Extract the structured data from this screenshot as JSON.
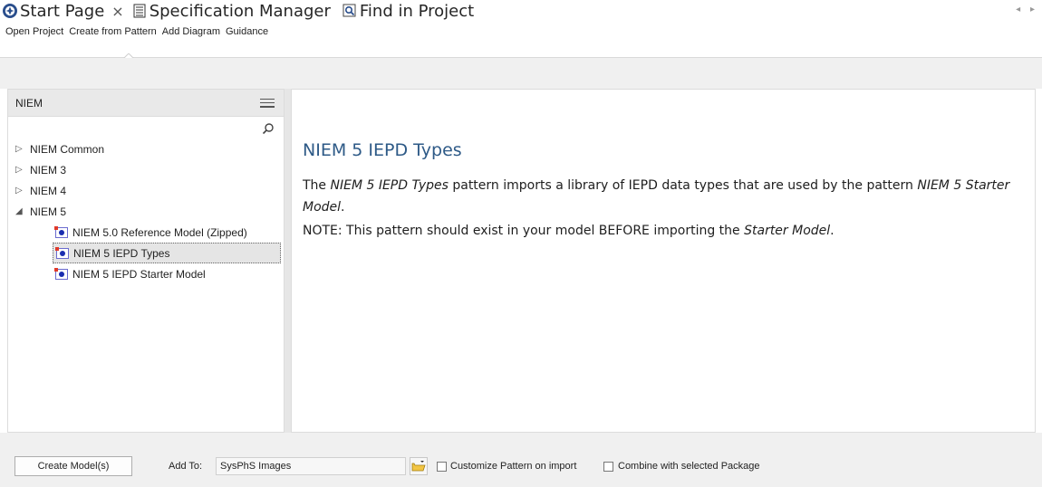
{
  "tabs": [
    {
      "label": "Start Page",
      "icon": "start-page-icon",
      "closable": true
    },
    {
      "label": "Specification Manager",
      "icon": "spec-manager-icon"
    },
    {
      "label": "Find in Project",
      "icon": "find-in-project-icon"
    }
  ],
  "toolbar": {
    "items": [
      "Open Project",
      "Create from Pattern",
      "Add Diagram",
      "Guidance"
    ],
    "active_index": 1
  },
  "tree": {
    "header": "NIEM",
    "nodes": [
      {
        "label": "NIEM Common",
        "expanded": false
      },
      {
        "label": "NIEM 3",
        "expanded": false
      },
      {
        "label": "NIEM 4",
        "expanded": false
      },
      {
        "label": "NIEM 5",
        "expanded": true
      }
    ],
    "children": [
      {
        "label": "NIEM 5.0 Reference Model (Zipped)"
      },
      {
        "label": "NIEM 5 IEPD Types",
        "selected": true
      },
      {
        "label": "NIEM 5 IEPD Starter Model"
      }
    ]
  },
  "detail": {
    "title": "NIEM 5 IEPD Types",
    "p1_a": "The ",
    "p1_em1": "NIEM 5 IEPD Types",
    "p1_b": " pattern imports a library of IEPD data types that are used by the pattern ",
    "p1_em2": "NIEM 5 Starter Model",
    "p1_c": ".",
    "p2_a": "NOTE:  This pattern should exist in your model BEFORE importing the ",
    "p2_em": "Starter Model",
    "p2_b": "."
  },
  "bottom": {
    "create_button": "Create Model(s)",
    "add_to_label": "Add To:",
    "add_to_value": "SysPhS Images",
    "customize_label": "Customize Pattern on import",
    "combine_label": "Combine with selected Package"
  },
  "colors": {
    "accent_title": "#2e5a87",
    "selection_bg": "#e5e5e5"
  }
}
